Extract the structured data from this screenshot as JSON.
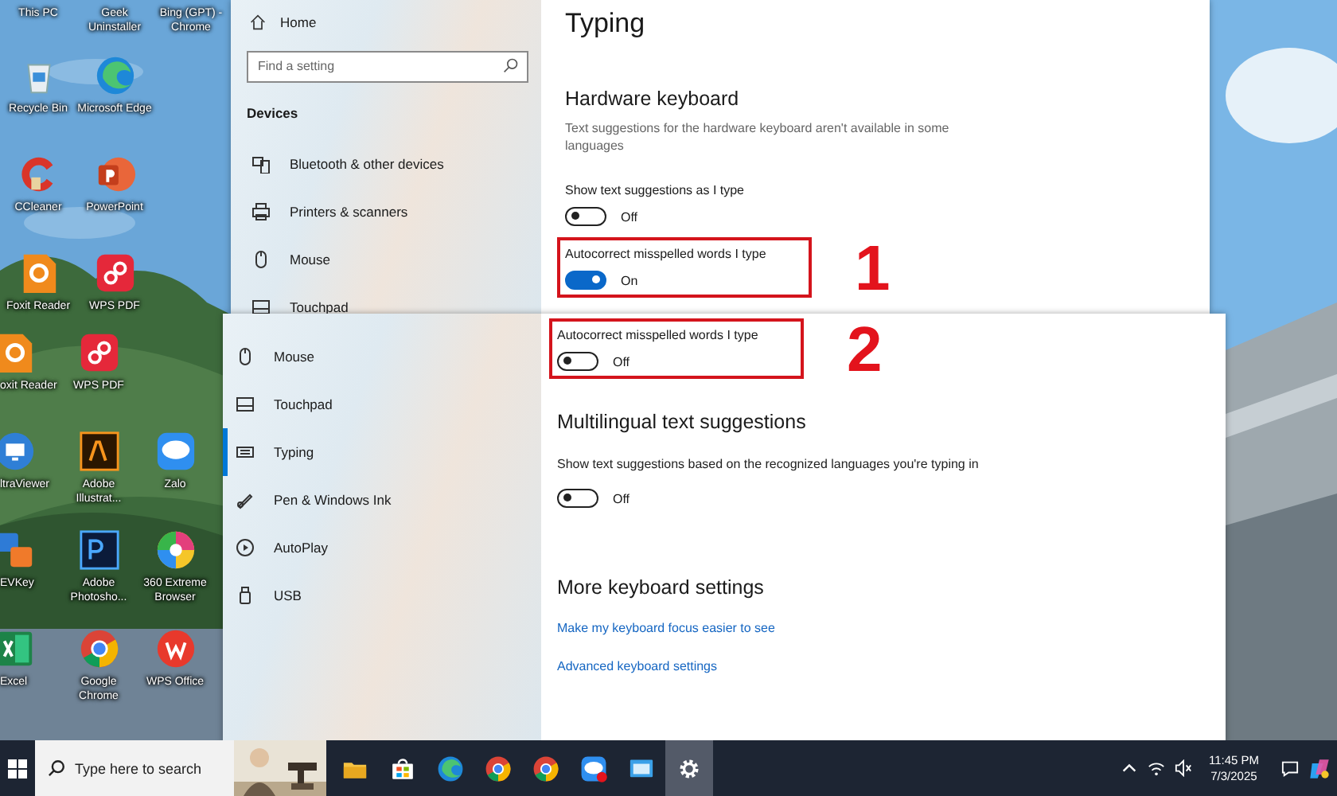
{
  "desktop": {
    "top_labels": [
      "This PC",
      "Geek Uninstaller",
      "Bing (GPT) - Chrome"
    ],
    "upper_icons": [
      [
        {
          "label": "Recycle Bin",
          "kind": "recycle"
        },
        {
          "label": "Microsoft Edge",
          "kind": "edge"
        }
      ],
      [
        {
          "label": "CCleaner",
          "kind": "ccleaner"
        },
        {
          "label": "PowerPoint",
          "kind": "powerpoint"
        }
      ],
      [
        {
          "label": "Foxit Reader",
          "kind": "foxit"
        },
        {
          "label": "WPS PDF",
          "kind": "wpspdf"
        }
      ]
    ],
    "lower_icons": [
      [
        {
          "label": "oxit Reader",
          "kind": "foxit"
        },
        {
          "label": "WPS PDF",
          "kind": "wpspdf"
        }
      ],
      [
        {
          "label": "ltraViewer",
          "kind": "ultraviewer"
        },
        {
          "label": "Adobe Illustrat...",
          "kind": "illustrator"
        },
        {
          "label": "Zalo",
          "kind": "zalo"
        }
      ],
      [
        {
          "label": "EVKey",
          "kind": "evkey"
        },
        {
          "label": "Adobe Photosho...",
          "kind": "photoshop"
        },
        {
          "label": "360 Extreme Browser",
          "kind": "browser360"
        }
      ],
      [
        {
          "label": "Excel",
          "kind": "excel"
        },
        {
          "label": "Google Chrome",
          "kind": "chrome"
        },
        {
          "label": "WPS Office",
          "kind": "wpsoffice"
        }
      ]
    ]
  },
  "settings_top": {
    "sidebar": {
      "home": "Home",
      "search": {
        "placeholder": "Find a setting"
      },
      "group": "Devices",
      "items": [
        {
          "label": "Bluetooth & other devices",
          "kind": "bluetooth"
        },
        {
          "label": "Printers & scanners",
          "kind": "printer"
        },
        {
          "label": "Mouse",
          "kind": "mouse"
        },
        {
          "label": "Touchpad",
          "kind": "touchpad"
        }
      ]
    },
    "title": "Typing",
    "section": {
      "heading": "Hardware keyboard",
      "description": "Text suggestions for the hardware keyboard aren't available in some languages",
      "toggles": [
        {
          "label": "Show text suggestions as I type",
          "on": false,
          "state_text": "Off",
          "highlighted": false
        },
        {
          "label": "Autocorrect misspelled words I type",
          "on": true,
          "state_text": "On",
          "highlighted": true,
          "callout": "1"
        }
      ]
    }
  },
  "settings_lower": {
    "sidebar": [
      {
        "label": "Mouse",
        "kind": "mouse",
        "selected": false
      },
      {
        "label": "Touchpad",
        "kind": "touchpad",
        "selected": false
      },
      {
        "label": "Typing",
        "kind": "typing",
        "selected": true
      },
      {
        "label": "Pen & Windows Ink",
        "kind": "pen",
        "selected": false
      },
      {
        "label": "AutoPlay",
        "kind": "autoplay",
        "selected": false
      },
      {
        "label": "USB",
        "kind": "usb",
        "selected": false
      }
    ],
    "toggles": [
      {
        "label": "Autocorrect misspelled words I type",
        "on": false,
        "state_text": "Off",
        "highlighted": true,
        "callout": "2"
      }
    ],
    "sections": [
      {
        "heading": "Multilingual text suggestions",
        "description": "Show text suggestions based on the recognized languages you're typing in",
        "toggles": [
          {
            "on": false,
            "state_text": "Off",
            "highlighted": false
          }
        ]
      },
      {
        "heading": "More keyboard settings",
        "links": [
          "Make my keyboard focus easier to see",
          "Advanced keyboard settings"
        ]
      }
    ]
  },
  "taskbar": {
    "search": {
      "placeholder": "Type here to search"
    },
    "apps": [
      {
        "kind": "folder",
        "selected": false,
        "badge": false
      },
      {
        "kind": "store",
        "selected": false,
        "badge": false
      },
      {
        "kind": "edge",
        "selected": false,
        "badge": false
      },
      {
        "kind": "chrome",
        "selected": false,
        "badge": false
      },
      {
        "kind": "chrome",
        "selected": false,
        "badge": false
      },
      {
        "kind": "zalo",
        "selected": false,
        "badge": true
      },
      {
        "kind": "remote",
        "selected": false,
        "badge": false
      },
      {
        "kind": "gear",
        "selected": true,
        "badge": false
      }
    ],
    "time": "11:45 PM",
    "date": "7/3/2025"
  }
}
